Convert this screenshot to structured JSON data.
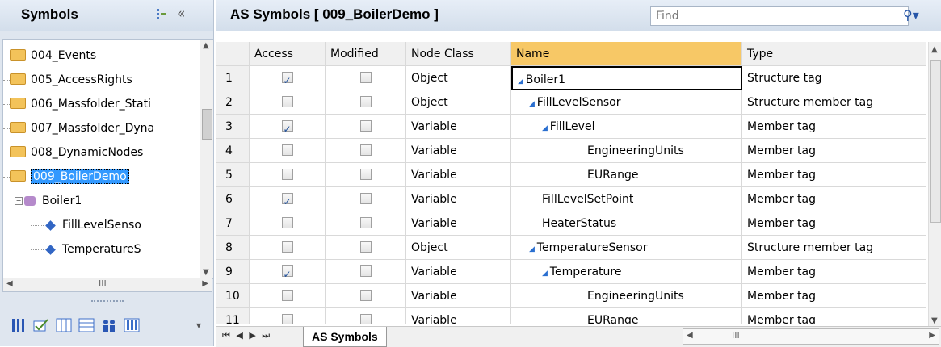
{
  "left": {
    "title": "Symbols",
    "collapse_glyph": "«",
    "tree": [
      {
        "label": "004_Events"
      },
      {
        "label": "005_AccessRights"
      },
      {
        "label": "006_Massfolder_Stati"
      },
      {
        "label": "007_Massfolder_Dyna"
      },
      {
        "label": "008_DynamicNodes"
      },
      {
        "label": "009_BoilerDemo"
      },
      {
        "label": "Boiler1"
      },
      {
        "label": "FillLevelSenso"
      },
      {
        "label": "TemperatureS"
      }
    ],
    "hscroll_thumb": "III"
  },
  "right": {
    "title": "AS Symbols [ 009_BoilerDemo ]",
    "find_placeholder": "Find",
    "columns": [
      "Access",
      "Modified",
      "Node Class",
      "Name",
      "Type"
    ],
    "rows": [
      {
        "num": "1",
        "access": true,
        "modified": false,
        "node_class": "Object",
        "name": "Boiler1",
        "type": "Structure tag"
      },
      {
        "num": "2",
        "access": false,
        "modified": false,
        "node_class": "Object",
        "name": "FillLevelSensor",
        "type": "Structure member tag"
      },
      {
        "num": "3",
        "access": true,
        "modified": false,
        "node_class": "Variable",
        "name": "FillLevel",
        "type": "Member tag"
      },
      {
        "num": "4",
        "access": false,
        "modified": false,
        "node_class": "Variable",
        "name": "EngineeringUnits",
        "type": "Member tag"
      },
      {
        "num": "5",
        "access": false,
        "modified": false,
        "node_class": "Variable",
        "name": "EURange",
        "type": "Member tag"
      },
      {
        "num": "6",
        "access": true,
        "modified": false,
        "node_class": "Variable",
        "name": "FillLevelSetPoint",
        "type": "Member tag"
      },
      {
        "num": "7",
        "access": false,
        "modified": false,
        "node_class": "Variable",
        "name": "HeaterStatus",
        "type": "Member tag"
      },
      {
        "num": "8",
        "access": false,
        "modified": false,
        "node_class": "Object",
        "name": "TemperatureSensor",
        "type": "Structure member tag"
      },
      {
        "num": "9",
        "access": true,
        "modified": false,
        "node_class": "Variable",
        "name": "Temperature",
        "type": "Member tag"
      },
      {
        "num": "10",
        "access": false,
        "modified": false,
        "node_class": "Variable",
        "name": "EngineeringUnits",
        "type": "Member tag"
      },
      {
        "num": "11",
        "access": false,
        "modified": false,
        "node_class": "Variable",
        "name": "EURange",
        "type": "Member tag"
      }
    ],
    "sheet_tab": "AS Symbols",
    "nav_glyphs": "⏮ ◀ ▶ ⏭",
    "hscroll_thumb": "III"
  },
  "colors": {
    "accent": "#3399ff",
    "header": "#d3deeb",
    "name_header": "#f7c866"
  }
}
